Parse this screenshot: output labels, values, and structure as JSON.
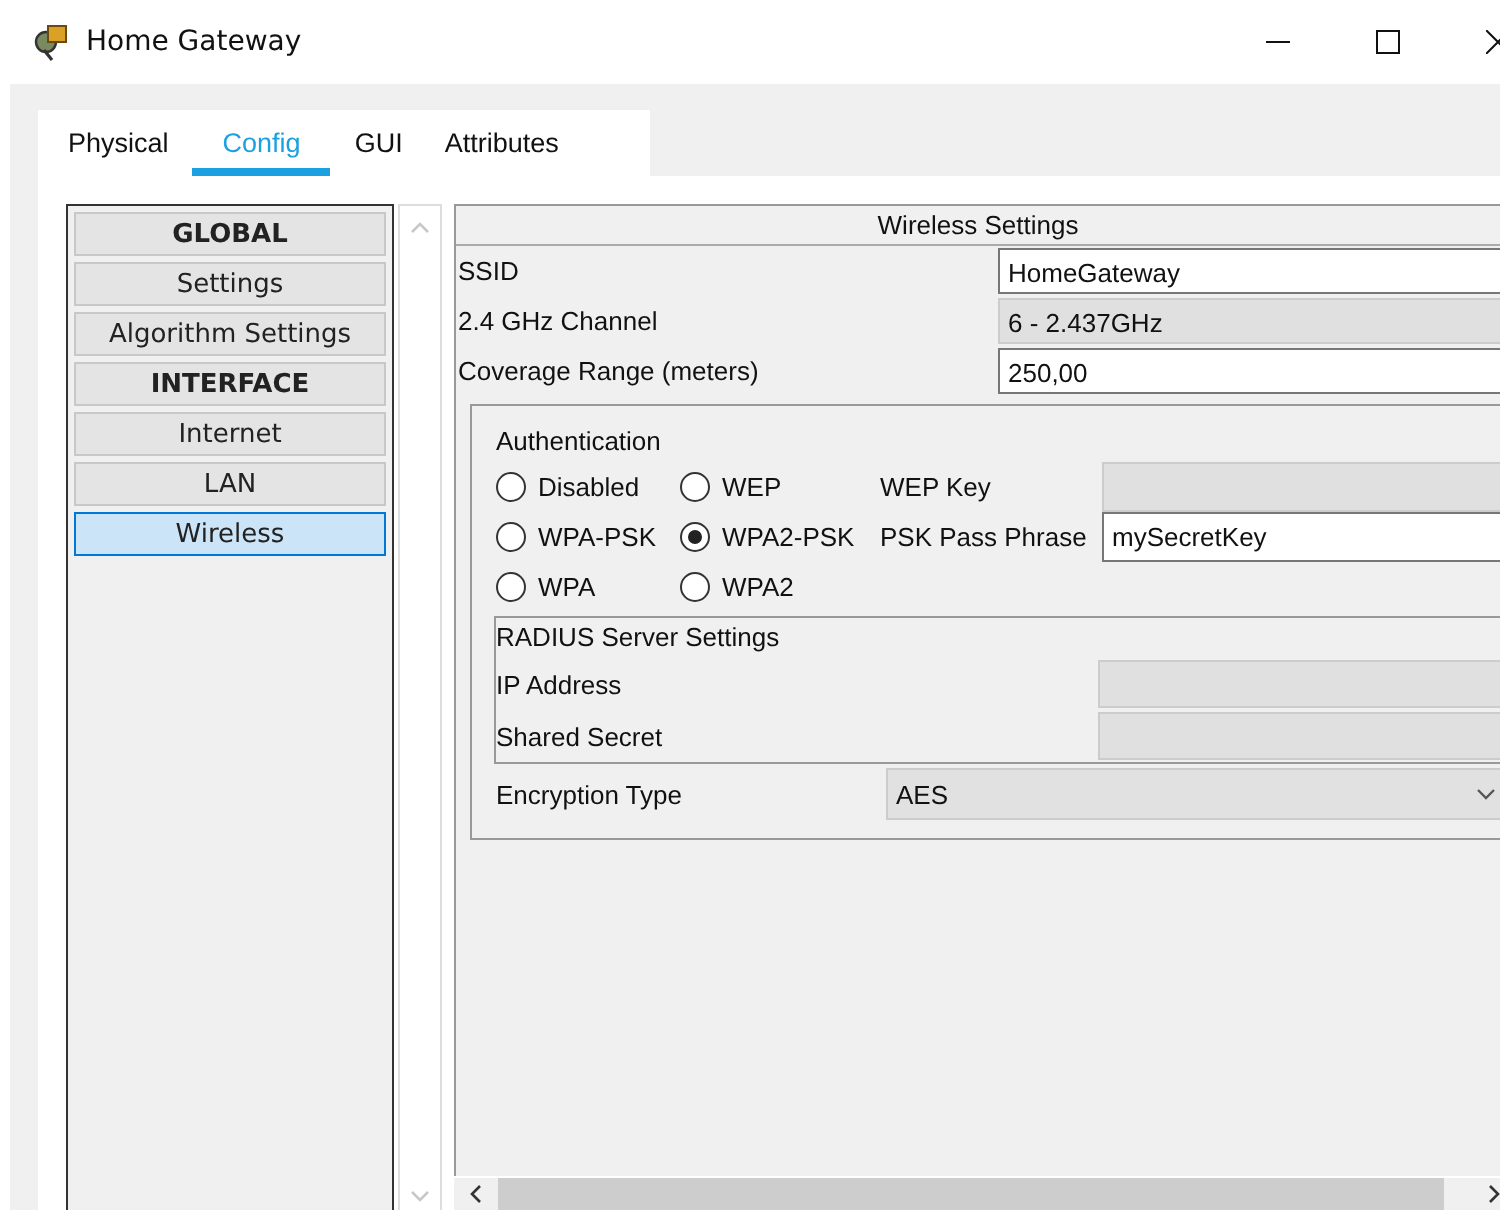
{
  "window": {
    "title": "Home Gateway"
  },
  "tabs": [
    {
      "label": "Physical",
      "selected": false
    },
    {
      "label": "Config",
      "selected": true
    },
    {
      "label": "GUI",
      "selected": false
    },
    {
      "label": "Attributes",
      "selected": false
    }
  ],
  "sidebar": {
    "items": [
      {
        "label": "GLOBAL",
        "kind": "header",
        "selected": false
      },
      {
        "label": "Settings",
        "kind": "item",
        "selected": false
      },
      {
        "label": "Algorithm Settings",
        "kind": "item",
        "selected": false
      },
      {
        "label": "INTERFACE",
        "kind": "header",
        "selected": false
      },
      {
        "label": "Internet",
        "kind": "item",
        "selected": false
      },
      {
        "label": "LAN",
        "kind": "item",
        "selected": false
      },
      {
        "label": "Wireless",
        "kind": "item",
        "selected": true
      }
    ]
  },
  "wireless_settings": {
    "title": "Wireless Settings",
    "fields": [
      {
        "label": "SSID",
        "value": "HomeGateway",
        "disabled": false
      },
      {
        "label": "2.4 GHz Channel",
        "value": "6 - 2.437GHz",
        "disabled": true
      },
      {
        "label": "Coverage Range (meters)",
        "value": "250,00",
        "disabled": false
      }
    ],
    "authentication": {
      "title": "Authentication",
      "options": [
        {
          "label": "Disabled",
          "selected": false
        },
        {
          "label": "WEP",
          "selected": false
        },
        {
          "label": "WPA-PSK",
          "selected": false
        },
        {
          "label": "WPA2-PSK",
          "selected": true
        },
        {
          "label": "WPA",
          "selected": false
        },
        {
          "label": "WPA2",
          "selected": false
        }
      ],
      "wep_key": {
        "label": "WEP Key",
        "disabled": true
      },
      "psk_pass_phrase": {
        "label": "PSK Pass Phrase",
        "value": "mySecretKey",
        "disabled": false
      },
      "radius": {
        "title": "RADIUS Server Settings",
        "fields": [
          {
            "label": "IP Address",
            "disabled": true
          },
          {
            "label": "Shared Secret",
            "disabled": true
          }
        ]
      },
      "encryption_type": {
        "label": "Encryption Type",
        "value": "AES"
      }
    }
  }
}
